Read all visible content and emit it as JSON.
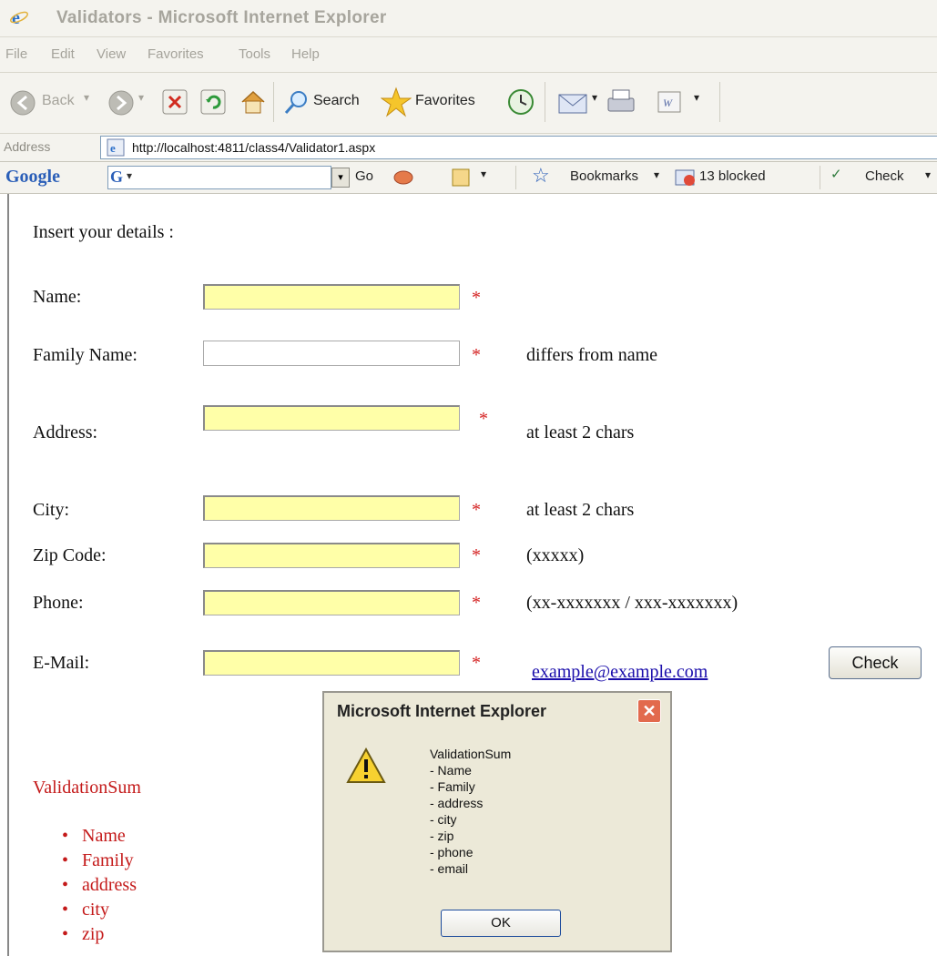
{
  "window": {
    "title": "Validators - Microsoft Internet Explorer"
  },
  "menu": [
    "File",
    "Edit",
    "View",
    "Favorites",
    "Tools",
    "Help"
  ],
  "toolbar": {
    "back": "Back",
    "search": "Search",
    "favorites": "Favorites"
  },
  "address": {
    "label": "Address",
    "url": "http://localhost:4811/class4/Validator1.aspx"
  },
  "google_bar": {
    "logo": "Google",
    "go": "Go",
    "bookmarks": "Bookmarks",
    "blocked": "13 blocked",
    "check": "Check"
  },
  "form": {
    "heading": "Insert your details :",
    "required_mark": "*",
    "fields": {
      "name": {
        "label": "Name:"
      },
      "family": {
        "label": "Family Name:",
        "hint": "differs from name"
      },
      "address": {
        "label": "Address:",
        "hint": "at least 2 chars"
      },
      "city": {
        "label": "City:",
        "hint": "at least 2 chars"
      },
      "zip": {
        "label": "Zip Code:",
        "hint": "(xxxxx)"
      },
      "phone": {
        "label": "Phone:",
        "hint": "(xx-xxxxxxx / xxx-xxxxxxx)"
      },
      "email": {
        "label": "E-Mail:",
        "hint": "example@example.com"
      }
    },
    "check_button": "Check"
  },
  "validation_summary": {
    "title": "ValidationSum",
    "items": [
      "Name",
      "Family",
      "address",
      "city",
      "zip"
    ]
  },
  "dialog": {
    "title": "Microsoft Internet Explorer",
    "message": "ValidationSum\n- Name\n- Family\n- address\n- city\n- zip\n- phone\n- email",
    "ok": "OK",
    "icon": "warning-icon"
  },
  "colors": {
    "required_field_bg": "#ffffa8",
    "error_red": "#c41a1a",
    "link_blue": "#1a0dab"
  }
}
